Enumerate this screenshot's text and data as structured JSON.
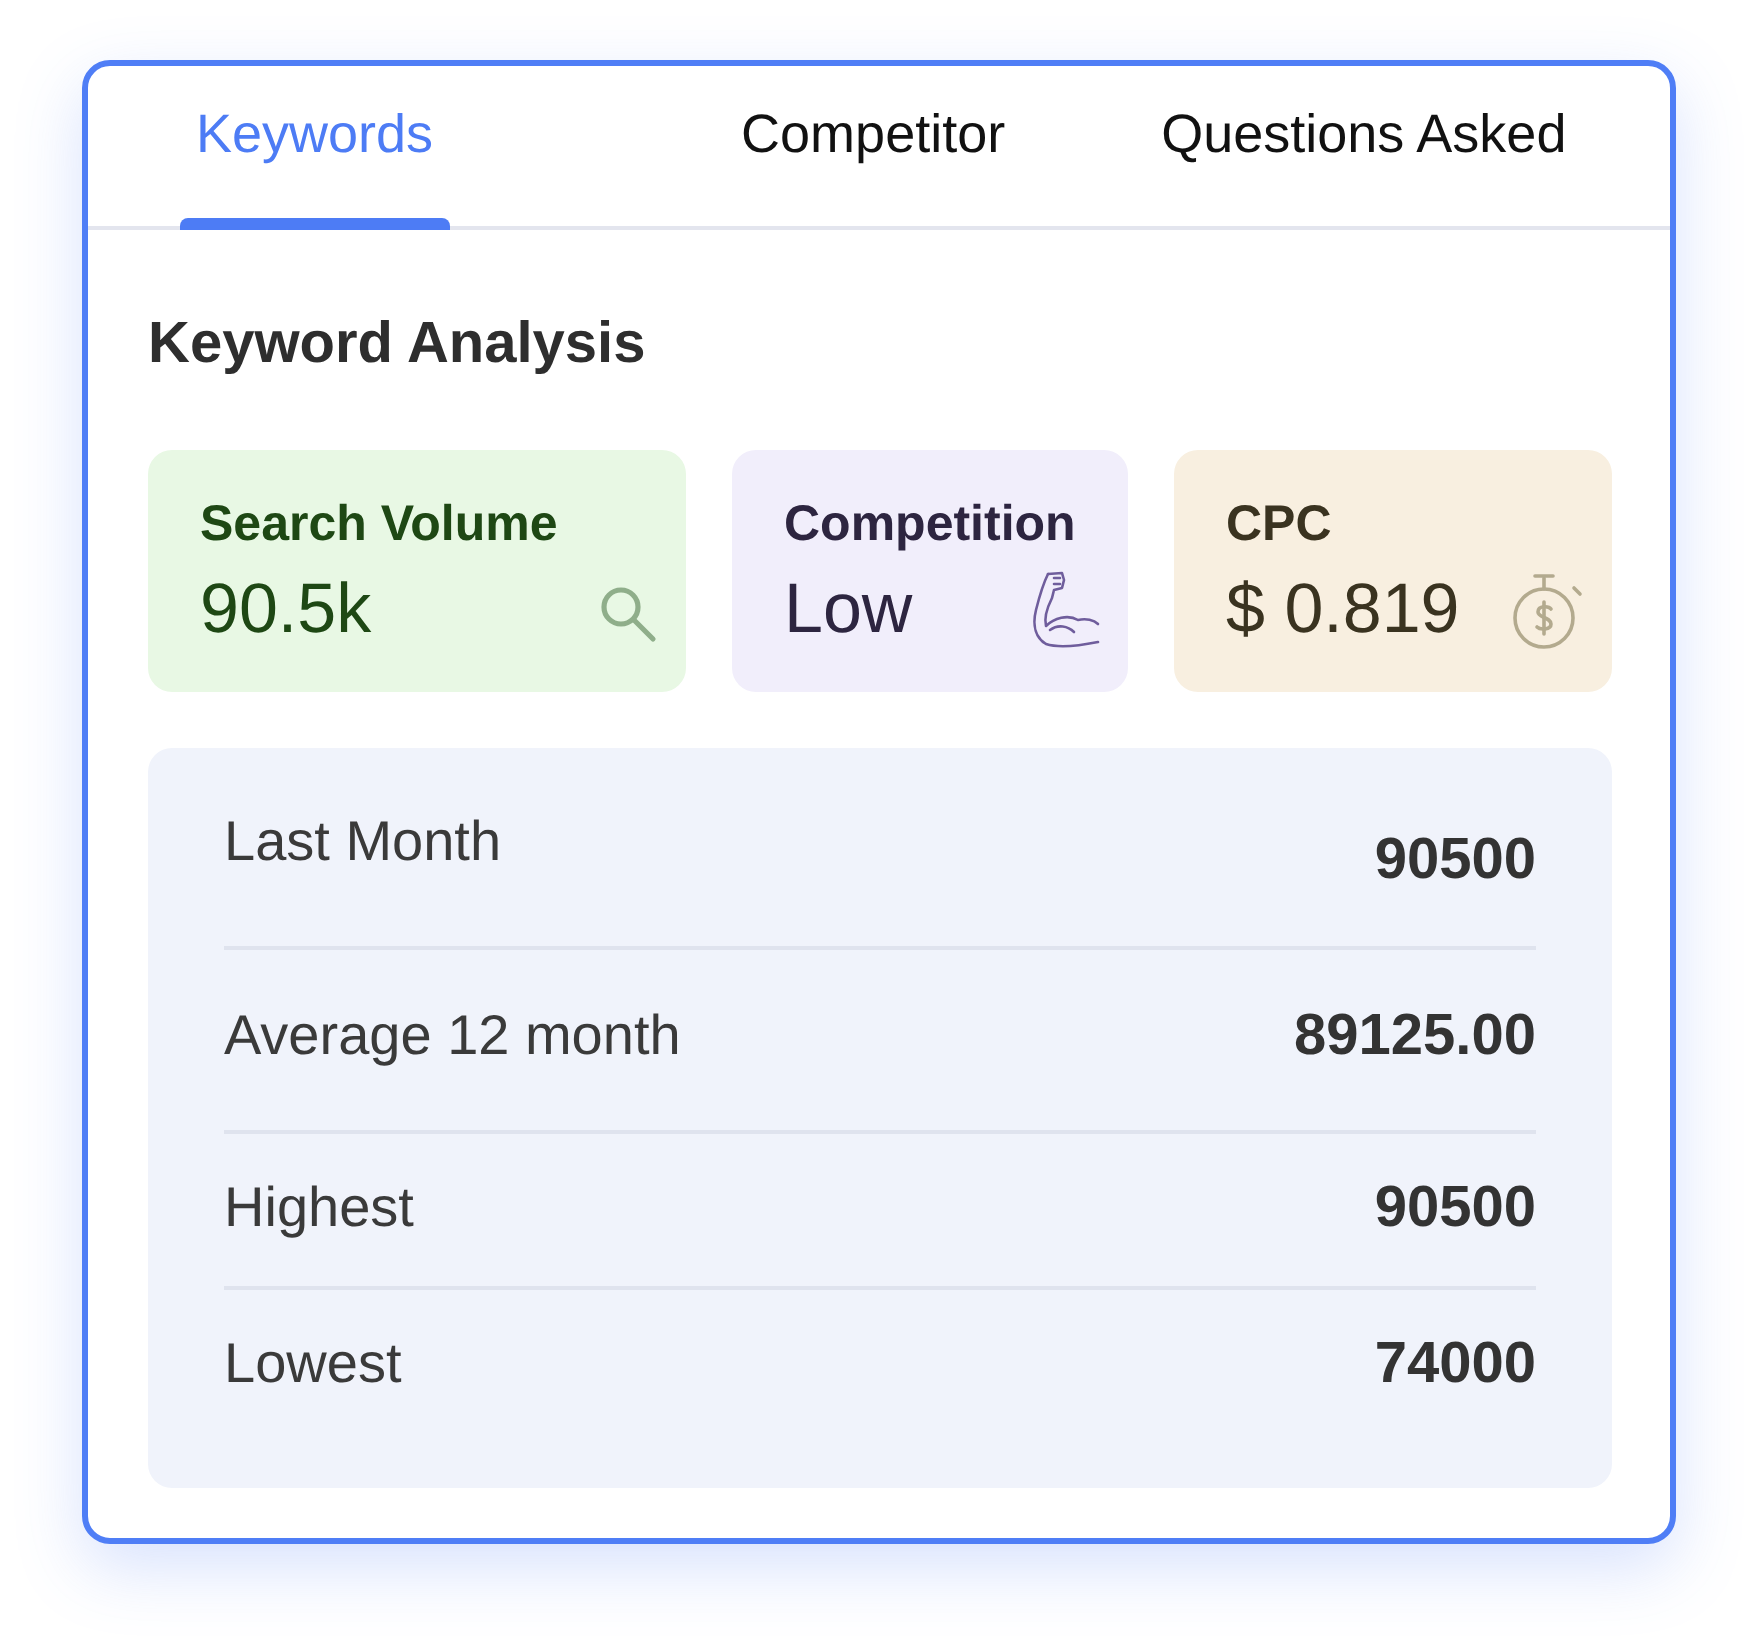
{
  "tabs": [
    {
      "label": "Keywords",
      "selected": true
    },
    {
      "label": "Competitor",
      "selected": false
    },
    {
      "label": "Questions Asked",
      "selected": false
    }
  ],
  "section_title": "Keyword Analysis",
  "metrics": [
    {
      "kind": "search",
      "title": "Search Volume",
      "value": "90.5k",
      "color": "#e8f8e4"
    },
    {
      "kind": "competition",
      "title": "Competition",
      "value": "Low",
      "color": "#f1eefb"
    },
    {
      "kind": "cpc",
      "title": "CPC",
      "value": "$ 0.819",
      "color": "#f8efe0"
    }
  ],
  "stats": [
    {
      "label": "Last Month",
      "value": "90500"
    },
    {
      "label": "Average 12 month",
      "value": "89125.00"
    },
    {
      "label": "Highest",
      "value": "90500"
    },
    {
      "label": "Lowest",
      "value": "74000"
    }
  ]
}
